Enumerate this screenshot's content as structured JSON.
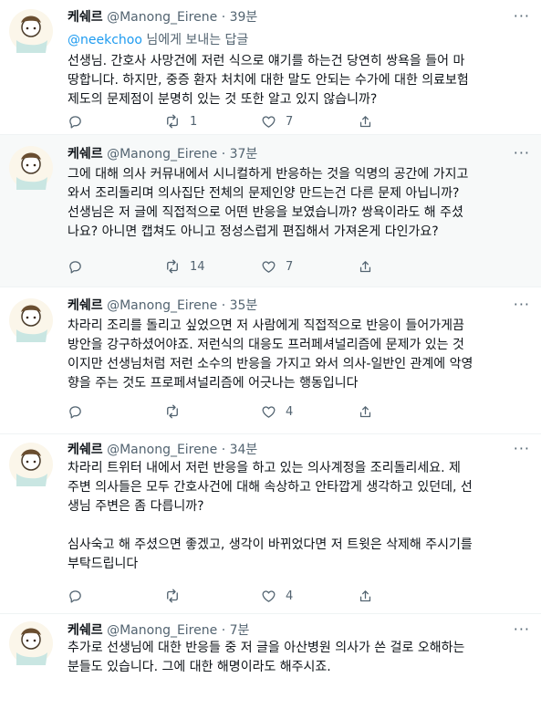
{
  "tweets": [
    {
      "name": "케쉐르",
      "handle": "@Manong_Eirene",
      "time": "39분",
      "reply_to": {
        "mention": "@neekchoo",
        "suffix": " 님에게 보내는 답글"
      },
      "lines": [
        "선생님. 간호사 사망건에 저런 식으로 얘기를 하는건 당연히 쌍욕을 들어 마",
        "땅합니다. 하지만, 중증 환자 처치에 대한 말도 안되는 수가에 대한 의료보험",
        "제도의 문제점이 분명히 있는 것 또한 알고 있지 않습니까?"
      ],
      "retweets": "1",
      "likes": "7"
    },
    {
      "name": "케쉐르",
      "handle": "@Manong_Eirene",
      "time": "37분",
      "lines": [
        "그에 대해 의사 커뮤내에서 시니컬하게 반응하는 것을 익명의 공간에 가지고",
        "와서 조리돌리며 의사집단 전체의 문제인양 만드는건 다른 문제 아닙니까?",
        "선생님은 저 글에 직접적으로 어떤 반응을 보였습니까? 쌍욕이라도 해 주셨",
        "나요? 아니면 캡쳐도 아니고 정성스럽게 편집해서 가져온게 다인가요?"
      ],
      "retweets": "14",
      "likes": "7"
    },
    {
      "name": "케쉐르",
      "handle": "@Manong_Eirene",
      "time": "35분",
      "lines": [
        "차라리 조리를 돌리고 싶었으면 저 사람에게 직접적으로 반응이 들어가게끔",
        "방안을 강구하셨어야죠. 저런식의 대응도 프러페셔널리즘에 문제가 있는 것",
        "이지만 선생님처럼 저런 소수의 반응을 가지고 와서 의사-일반인 관계에 악영",
        "향을 주는 것도 프로페셔널리즘에 어긋나는 행동입니다"
      ],
      "retweets": "",
      "likes": "4"
    },
    {
      "name": "케쉐르",
      "handle": "@Manong_Eirene",
      "time": "34분",
      "lines": [
        "차라리 트위터 내에서 저런 반응을 하고 있는 의사계정을 조리돌리세요. 제",
        "주변 의사들은 모두 간호사건에 대해 속상하고 안타깝게 생각하고 있던데, 선",
        "생님 주변은 좀 다릅니까?",
        "",
        "심사숙고 해 주셨으면 좋겠고, 생각이 바뀌었다면 저 트윗은 삭제해 주시기를",
        "부탁드립니다"
      ],
      "retweets": "",
      "likes": "4"
    },
    {
      "name": "케쉐르",
      "handle": "@Manong_Eirene",
      "time": "7분",
      "lines": [
        "추가로 선생님에 대한 반응들 중 저 글을 아산병원 의사가 쓴 걸로 오해하는",
        "분들도 있습니다. 그에 대한 해명이라도 해주시죠."
      ],
      "retweets": "",
      "likes": ""
    }
  ],
  "icons": [
    "avatar",
    "reply-icon",
    "retweet-icon",
    "like-icon",
    "share-icon",
    "more-icon"
  ],
  "colors": {
    "text": "#0f1419",
    "secondary": "#536471",
    "link": "#1d9bf0",
    "highlight_bg": "#f7f9f9",
    "divider": "#eff3f4"
  }
}
